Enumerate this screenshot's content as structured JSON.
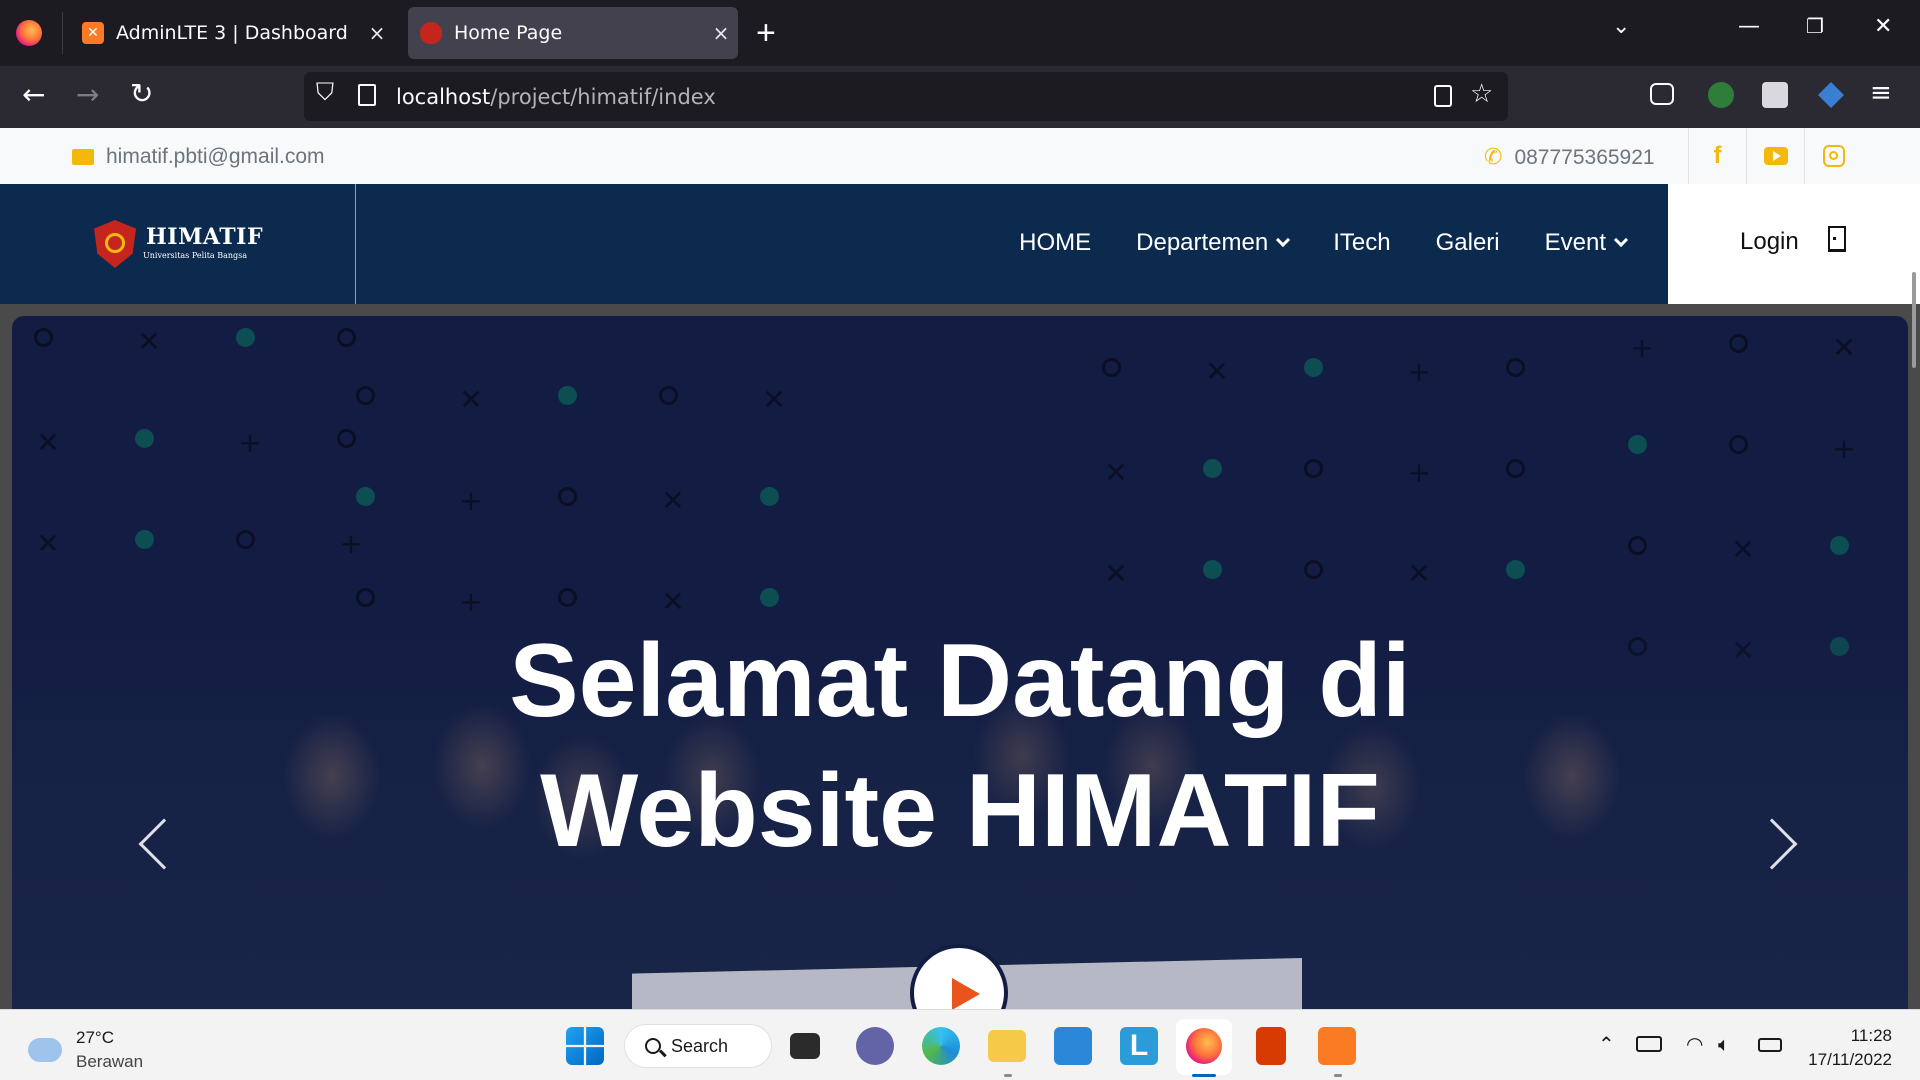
{
  "browser": {
    "tabs": [
      {
        "label": "AdminLTE 3 | Dashboard",
        "favicon": "xampp-icon",
        "active": false
      },
      {
        "label": "Home Page",
        "favicon": "himatif-icon",
        "active": true
      }
    ],
    "url_host": "localhost",
    "url_path": "/project/himatif/index",
    "close_glyph": "×",
    "new_tab_glyph": "+"
  },
  "topbar": {
    "email": "himatif.pbti@gmail.com",
    "phone": "087775365921",
    "social_facebook": "f",
    "accent_color": "#f2b90c"
  },
  "nav": {
    "brand_title": "HIMATIF",
    "brand_subtitle": "Universitas Pelita Bangsa",
    "links": [
      "HOME",
      "Departemen",
      "ITech",
      "Galeri",
      "Event"
    ],
    "login": "Login",
    "bg_color": "#0b2a4e"
  },
  "hero": {
    "title_line1": "Selamat Datang di",
    "title_line2": "Website HIMATIF"
  },
  "taskbar": {
    "temperature": "27°C",
    "weather": "Berawan",
    "search_label": "Search",
    "time": "11:28",
    "date": "17/11/2022"
  }
}
